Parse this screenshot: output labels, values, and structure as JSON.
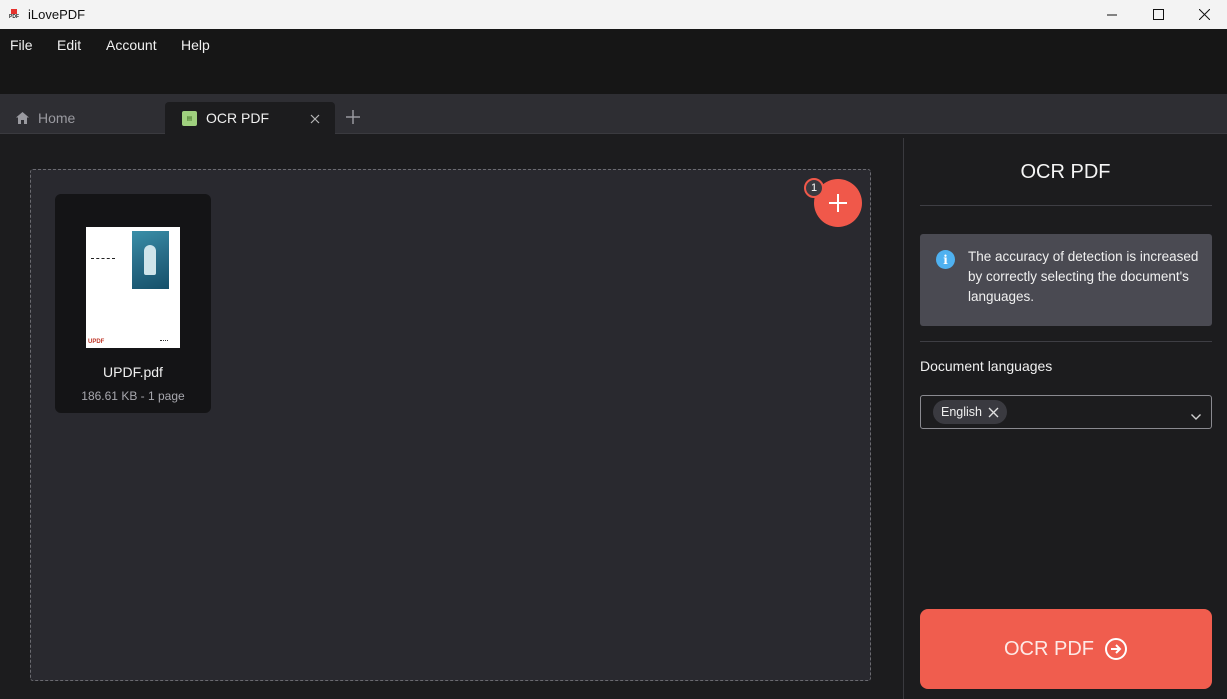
{
  "window": {
    "title": "iLovePDF",
    "logo_text": "PDF"
  },
  "menu": {
    "file": "File",
    "edit": "Edit",
    "account": "Account",
    "help": "Help"
  },
  "tabs": {
    "home": "Home",
    "active": "OCR PDF"
  },
  "file": {
    "name": "UPDF.pdf",
    "meta": "186.61 KB - 1 page",
    "thumb_brand": "UPDF"
  },
  "add_files": {
    "count": "1"
  },
  "panel": {
    "title": "OCR PDF",
    "info": "The accuracy of detection is increased by correctly selecting the document's languages.",
    "languages_label": "Document languages",
    "selected_language": "English",
    "action_label": "OCR PDF"
  },
  "colors": {
    "accent": "#f05d4e",
    "info": "#4fb1f0",
    "background": "#1c1c1e"
  }
}
